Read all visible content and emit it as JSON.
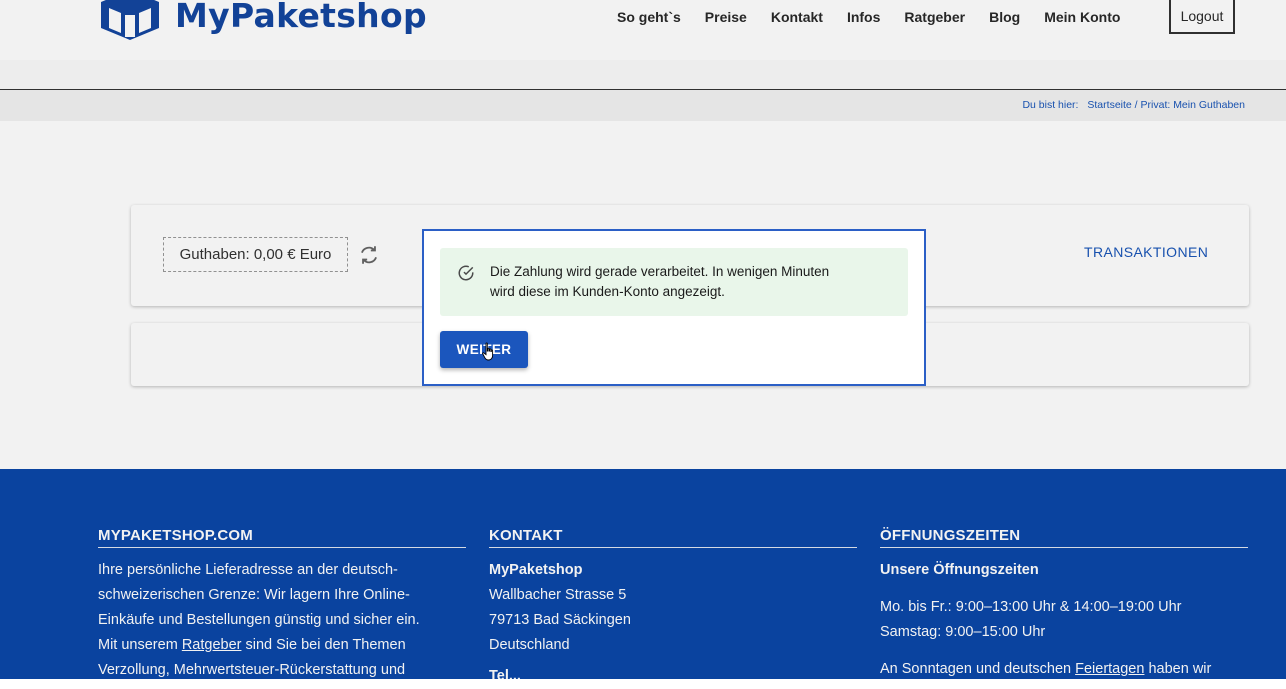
{
  "header": {
    "brand": "MyPaketshop",
    "nav": [
      "So geht`s",
      "Preise",
      "Kontakt",
      "Infos",
      "Ratgeber",
      "Blog",
      "Mein Konto"
    ],
    "logout_label": "Logout"
  },
  "breadcrumb": {
    "label": "Du bist hier:",
    "home": "Startseite",
    "separator": "/",
    "current": "Privat: Mein Guthaben"
  },
  "account": {
    "balance": "Guthaben: 0,00 € Euro",
    "transactions_label": "TRANSAKTIONEN"
  },
  "modal": {
    "message_line1": "Die Zahlung wird gerade verarbeitet. In wenigen Minuten",
    "message_line2": "wird diese im Kunden-Konto angezeigt.",
    "button_label": "WEITER"
  },
  "footer": {
    "col1": {
      "heading": "MYPAKETSHOP.COM",
      "line1": "Ihre persönliche Lieferadresse an der deutsch-",
      "line2": "schweizerischen Grenze: Wir lagern Ihre Online-",
      "line3": "Einkäufe und Bestellungen günstig und sicher ein.",
      "line4_pre": "Mit unserem",
      "line4_link": "Ratgeber",
      "line4_post": "sind Sie bei den Themen",
      "line5": "Verzollung, Mehrwertsteuer-Rückerstattung und"
    },
    "col2": {
      "heading": "KONTAKT",
      "name": "MyPaketshop",
      "street": "Wallbacher Strasse 5",
      "city": "79713 Bad Säckingen",
      "country": "Deutschland",
      "partial": "Tel..."
    },
    "col3": {
      "heading": "ÖFFNUNGSZEITEN",
      "subheading": "Unsere Öffnungszeiten",
      "weekdays": "Mo. bis Fr.: 9:00–13:00 Uhr & 14:00–19:00 Uhr",
      "saturday": "Samstag: 9:00–15:00 Uhr",
      "sunday_pre": "An Sonntagen und deutschen",
      "sunday_link": "Feiertagen",
      "sunday_post": "haben wir"
    }
  },
  "colors": {
    "brand_blue": "#1446a0",
    "footer_bg": "#0b47a8",
    "button_bg": "#1b56bd",
    "alert_bg": "#e9f6ea"
  }
}
